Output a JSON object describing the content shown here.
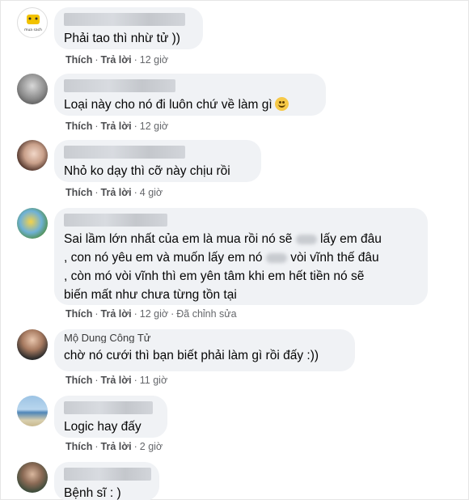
{
  "comments": [
    {
      "text": "Phải tao thì nhừ tử ))",
      "like": "Thích",
      "reply": "Trả lời",
      "time": "12 giờ",
      "avatar_label": "mua sach"
    },
    {
      "text": "Loại này cho nó đi luôn chứ về làm gì",
      "like": "Thích",
      "reply": "Trả lời",
      "time": "12 giờ"
    },
    {
      "text": "Nhỏ ko dạy thì cỡ này chịu rồi",
      "like": "Thích",
      "reply": "Trả lời",
      "time": "4 giờ"
    },
    {
      "text_line1": "Sai lầm lớn nhất của em là mua rồi nó sẽ",
      "text_line1_end": "lấy em đâu",
      "text_line2": ", con nó yêu em và muốn lấy em nó",
      "text_line2_end": "vòi vĩnh thế đâu",
      "text_line3": ", còn mó vòi vĩnh thì em yên tâm khi em hết tiền nó sẽ",
      "text_line4": "biến mất như chưa từng tồn tại",
      "like": "Thích",
      "reply": "Trả lời",
      "time": "12 giờ",
      "edited": "Đã chỉnh sửa"
    },
    {
      "author": "Mộ Dung Công Tử",
      "text": "chờ nó cưới thì bạn biết phải làm gì rồi đấy :))",
      "like": "Thích",
      "reply": "Trả lời",
      "time": "11 giờ"
    },
    {
      "text": "Logic hay đấy",
      "like": "Thích",
      "reply": "Trả lời",
      "time": "2 giờ"
    },
    {
      "text": "Bệnh sĩ : )"
    }
  ],
  "separator": "·",
  "colors": {
    "bubble": "#f0f2f5",
    "meta": "#65676b"
  }
}
